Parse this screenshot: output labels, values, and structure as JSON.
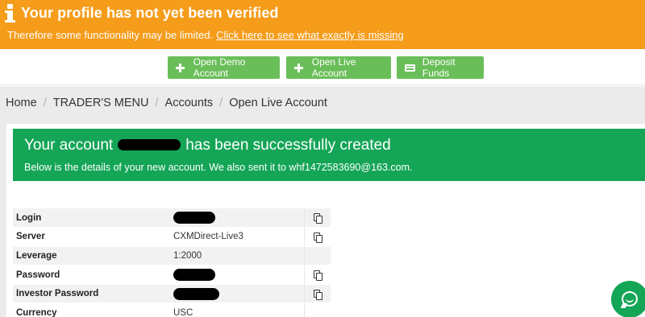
{
  "banner": {
    "title": "Your profile has not yet been verified",
    "text": "Therefore some functionality may be limited.",
    "link": "Click here to see what exactly is missing",
    "color": "#f59c1a"
  },
  "actions": {
    "demo": "Open Demo Account",
    "live": "Open Live Account",
    "deposit": "Deposit Funds",
    "color": "#6abe59"
  },
  "breadcrumb": {
    "home": "Home",
    "menu": "TRADER'S MENU",
    "accounts": "Accounts",
    "current": "Open Live Account",
    "separator": "/"
  },
  "success": {
    "before": "Your account",
    "after": "has been successfully created",
    "details": "Below is the details of your new account. We also sent it to whf1472583690@163.com.",
    "color": "#14a556"
  },
  "details": {
    "login_label": "Login",
    "server_label": "Server",
    "server_value": "CXMDirect-Live3",
    "leverage_label": "Leverage",
    "leverage_value": "1:2000",
    "password_label": "Password",
    "investor_label": "Investor Password",
    "currency_label": "Currency",
    "currency_value": "USC"
  },
  "icons": {
    "info": "info-icon",
    "plus": "plus-icon",
    "card": "credit-card-icon",
    "copy": "copy-icon",
    "chat": "chat-icon"
  }
}
